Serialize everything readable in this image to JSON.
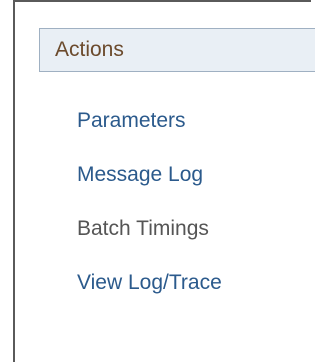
{
  "actions_panel": {
    "title": "Actions",
    "items": [
      {
        "label": "Parameters",
        "link": true
      },
      {
        "label": "Message Log",
        "link": true
      },
      {
        "label": "Batch Timings",
        "link": false
      },
      {
        "label": "View Log/Trace",
        "link": true
      }
    ]
  },
  "colors": {
    "header_background": "#e9eff5",
    "header_border": "#9fb0c2",
    "title_text": "#6b4a2c",
    "link_text": "#2b5a8c",
    "static_text": "#555555"
  }
}
